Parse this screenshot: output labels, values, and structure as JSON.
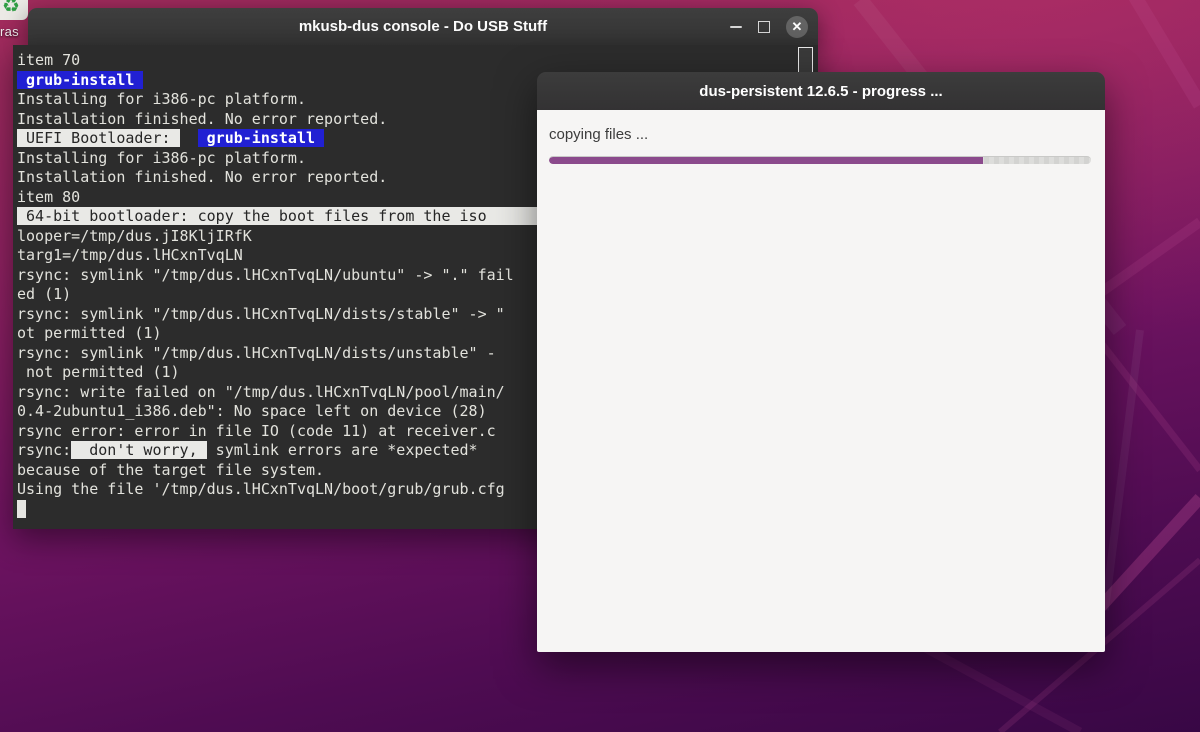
{
  "desktop": {
    "icon": {
      "glyph": "♻",
      "label": "ras"
    },
    "background_top_color": "#a22c5c",
    "background_bottom_color": "#380745"
  },
  "terminal": {
    "title": "mkusb-dus console - Do USB Stuff",
    "colors": {
      "background": "#2c2c2c",
      "text": "#e2e2dc",
      "highlight_blue": "#2120d3",
      "highlight_light": "#e9e9e6"
    },
    "lines": [
      [
        {
          "t": "item 70"
        }
      ],
      [
        {
          "t": " grub-install ",
          "s": "b"
        }
      ],
      [
        {
          "t": "Installing for i386-pc platform."
        }
      ],
      [
        {
          "t": "Installation finished. No error reported."
        }
      ],
      [
        {
          "t": " UEFI Bootloader: ",
          "s": "l"
        },
        {
          "t": "  "
        },
        {
          "t": " grub-install ",
          "s": "b"
        }
      ],
      [
        {
          "t": "Installing for i386-pc platform."
        }
      ],
      [
        {
          "t": "Installation finished. No error reported."
        }
      ],
      [
        {
          "t": "item 80"
        }
      ],
      [
        {
          "t": " 64-bit bootloader: copy the boot files from the iso ",
          "s": "l ext"
        }
      ],
      [
        {
          "t": "looper=/tmp/dus.jI8KljIRfK"
        }
      ],
      [
        {
          "t": "targ1=/tmp/dus.lHCxnTvqLN"
        }
      ],
      [
        {
          "t": "rsync: symlink \"/tmp/dus.lHCxnTvqLN/ubuntu\" -> \".\" fail"
        }
      ],
      [
        {
          "t": "ed (1)"
        }
      ],
      [
        {
          "t": "rsync: symlink \"/tmp/dus.lHCxnTvqLN/dists/stable\" -> \""
        }
      ],
      [
        {
          "t": "ot permitted (1)"
        }
      ],
      [
        {
          "t": "rsync: symlink \"/tmp/dus.lHCxnTvqLN/dists/unstable\" - "
        }
      ],
      [
        {
          "t": " not permitted (1)"
        }
      ],
      [
        {
          "t": "rsync: write failed on \"/tmp/dus.lHCxnTvqLN/pool/main/"
        }
      ],
      [
        {
          "t": "0.4-2ubuntu1_i386.deb\": No space left on device (28)"
        }
      ],
      [
        {
          "t": "rsync error: error in file IO (code 11) at receiver.c"
        }
      ],
      [
        {
          "t": "rsync:"
        },
        {
          "t": "  don't worry, ",
          "s": "l"
        },
        {
          "t": " symlink errors are *expected*"
        }
      ],
      [
        {
          "t": "because of the target file system."
        }
      ],
      [
        {
          "t": "Using the file '/tmp/dus.lHCxnTvqLN/boot/grub/grub.cfg"
        }
      ],
      [
        {
          "t": " ",
          "s": "cursor"
        }
      ]
    ]
  },
  "dialog": {
    "title": "dus-persistent 12.6.5 - progress ...",
    "status_text": "copying files ...",
    "progress_percent": 80,
    "progress_fill_color": "#8b4a8c"
  }
}
